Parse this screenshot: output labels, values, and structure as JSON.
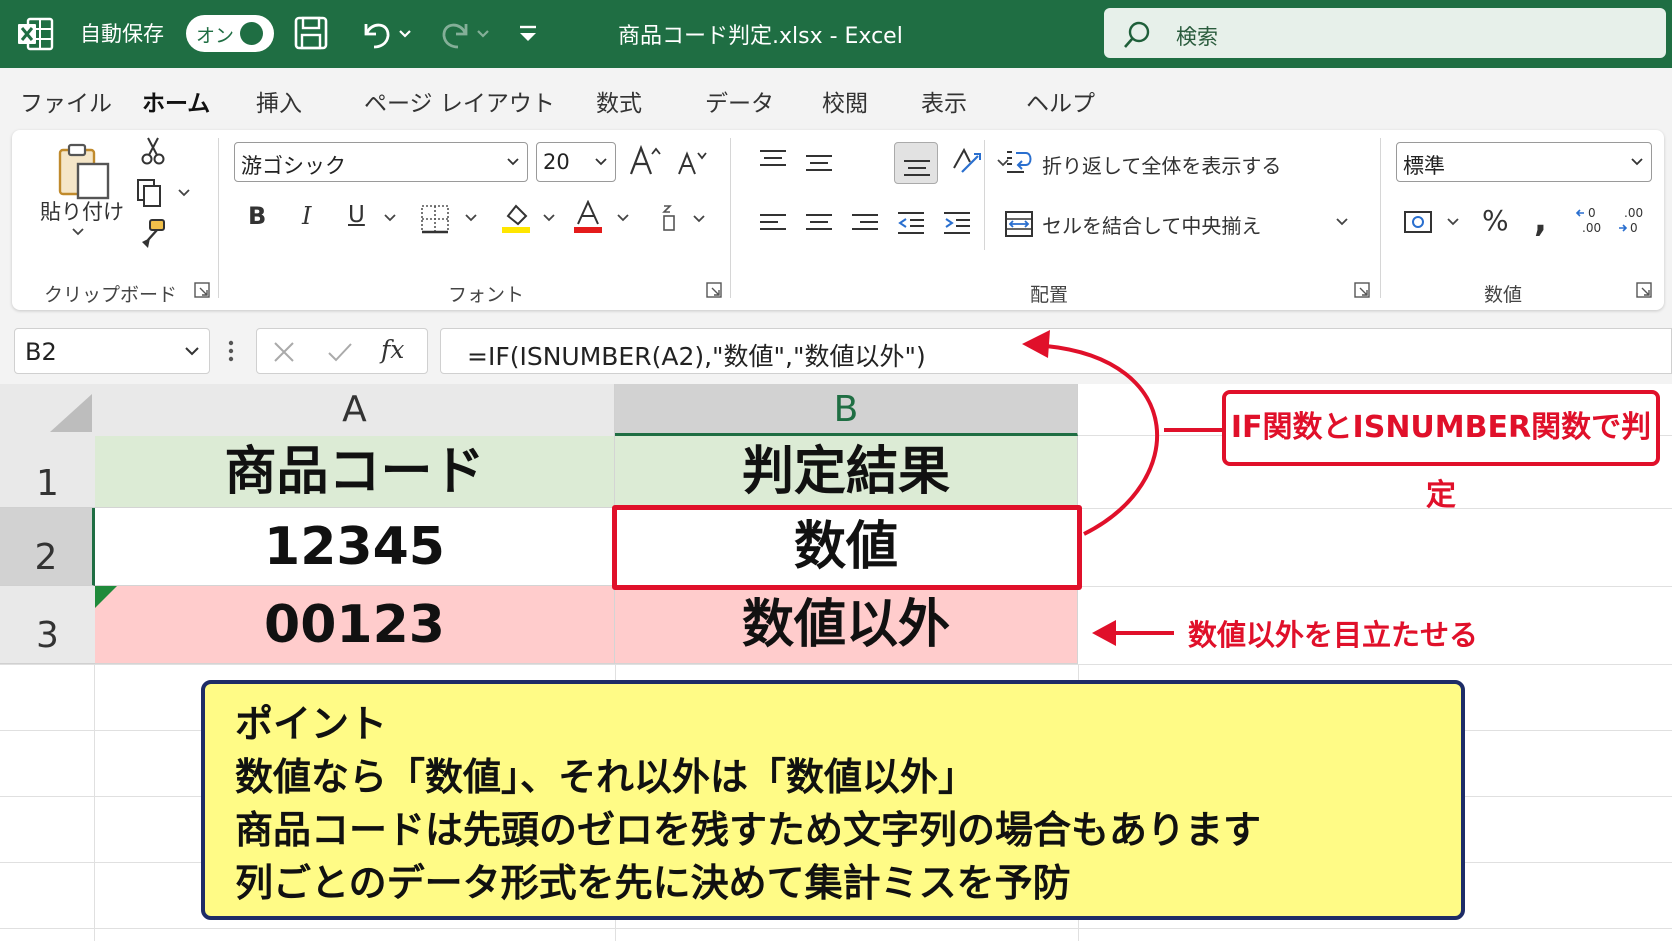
{
  "titlebar": {
    "autosave_label": "自動保存",
    "autosave_state": "オン",
    "document_title": "商品コード判定.xlsx  -  Excel",
    "search_placeholder": "検索"
  },
  "menu": {
    "tabs": [
      "ファイル",
      "ホーム",
      "挿入",
      "ページ レイアウト",
      "数式",
      "データ",
      "校閲",
      "表示",
      "ヘルプ"
    ],
    "active": "ホーム"
  },
  "ribbon": {
    "clipboard": {
      "paste_label": "貼り付け",
      "group_label": "クリップボード"
    },
    "font": {
      "font_name": "游ゴシック",
      "font_size": "20",
      "group_label": "フォント"
    },
    "alignment": {
      "wrap_text": "折り返して全体を表示する",
      "merge_center": "セルを結合して中央揃え",
      "group_label": "配置"
    },
    "number": {
      "format": "標準",
      "group_label": "数値"
    }
  },
  "formula_bar": {
    "name_box": "B2",
    "fx_label": "fx",
    "formula": "=IF(ISNUMBER(A2),\"数値\",\"数値以外\")"
  },
  "sheet": {
    "columns": [
      "A",
      "B"
    ],
    "rows": [
      "1",
      "2",
      "3"
    ],
    "cells": {
      "a1": "商品コード",
      "b1": "判定結果",
      "a2": "12345",
      "b2": "数値",
      "a3": "00123",
      "b3": "数値以外"
    }
  },
  "annotations": {
    "callout": "IF関数とISNUMBER関数で判定",
    "highlight_note": "数値以外を目立たせる",
    "point_box": [
      "ポイント",
      "数値なら「数値」、それ以外は「数値以外」",
      "商品コードは先頭のゼロを残すため文字列の場合もあります",
      "列ごとのデータ形式を先に決めて集計ミスを予防"
    ]
  },
  "colors": {
    "excel_green": "#1f6e43",
    "header_fill": "#dcebd5",
    "highlight_fill": "#ffcccc",
    "annotation_red": "#e0102a",
    "point_fill": "#fffb86",
    "point_border": "#1d2c66"
  }
}
